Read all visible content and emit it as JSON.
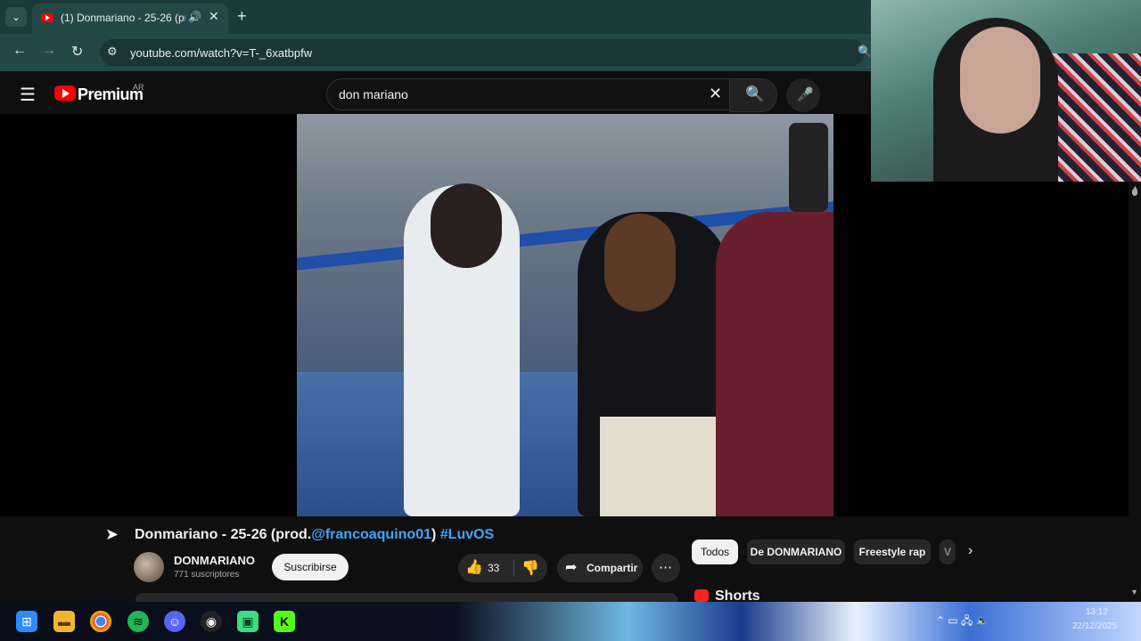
{
  "browser": {
    "tab_title": "(1) Donmariano - 25-26 (prod.",
    "tab_audio_icon": "speaker-icon",
    "tab_close": "✕",
    "new_tab": "+",
    "url": "youtube.com/watch?v=T-_6xatbpfw"
  },
  "youtube": {
    "logo_text": "Premium",
    "country_code": "AR",
    "search_value": "don mariano",
    "accent_color": "#ff0000"
  },
  "video": {
    "title_prefix": "Donmariano - 25-26 (prod.",
    "title_mention": "@francoaquino01",
    "title_paren_close": ")",
    "title_hashtag": "#LuvOS",
    "channel_name": "DONMARIANO",
    "subscribers": "771 suscriptores",
    "subscribe_label": "Suscribirse",
    "like_count": "33",
    "share_label": "Compartir"
  },
  "chips": {
    "all": "Todos",
    "from_channel": "De DONMARIANO",
    "freestyle": "Freestyle rap",
    "partial": "V"
  },
  "shorts_label": "Shorts",
  "taskbar": {
    "time": "13:12",
    "date": "22/12/2025"
  }
}
